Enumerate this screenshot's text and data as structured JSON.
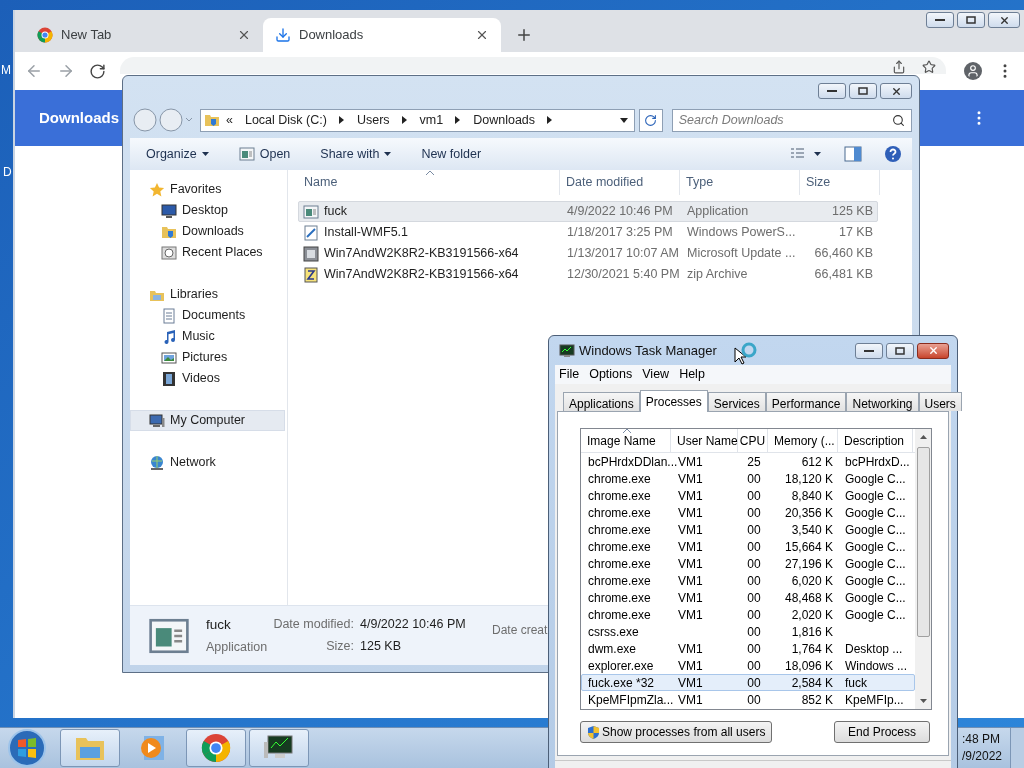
{
  "desktop": {
    "icon_labels": [
      "M",
      "D"
    ]
  },
  "browser": {
    "tabs": [
      {
        "title": "New Tab",
        "kind": "chrome",
        "selected": false
      },
      {
        "title": "Downloads",
        "kind": "download",
        "selected": true
      }
    ],
    "page_title": "Downloads"
  },
  "explorer": {
    "path_overflow": "«",
    "breadcrumb": [
      "Local Disk (C:)",
      "Users",
      "vm1",
      "Downloads"
    ],
    "search_placeholder": "Search Downloads",
    "toolbar": [
      {
        "label": "Organize",
        "kind": "menu"
      },
      {
        "label": "Open",
        "kind": "open"
      },
      {
        "label": "Share with",
        "kind": "menu"
      },
      {
        "label": "New folder",
        "kind": "plain"
      }
    ],
    "nav": [
      {
        "label": "Favorites",
        "kind": "star",
        "selected": false,
        "children": [
          {
            "label": "Desktop",
            "kind": "desktop",
            "selected": false
          },
          {
            "label": "Downloads",
            "kind": "folder",
            "selected": false
          },
          {
            "label": "Recent Places",
            "kind": "recent",
            "selected": false
          }
        ]
      },
      {
        "label": "Libraries",
        "kind": "library",
        "selected": false,
        "children": [
          {
            "label": "Documents",
            "kind": "documents",
            "selected": false
          },
          {
            "label": "Music",
            "kind": "music",
            "selected": false
          },
          {
            "label": "Pictures",
            "kind": "pictures",
            "selected": false
          },
          {
            "label": "Videos",
            "kind": "videos",
            "selected": false
          }
        ]
      },
      {
        "label": "My Computer",
        "kind": "computer",
        "selected": true
      },
      {
        "label": "Network",
        "kind": "network",
        "selected": false
      }
    ],
    "columns": [
      "Name",
      "Date modified",
      "Type",
      "Size"
    ],
    "files": [
      {
        "name": "fuck",
        "date": "4/9/2022 10:46 PM",
        "type": "Application",
        "size": "125 KB",
        "kind": "app",
        "selected": true
      },
      {
        "name": "Install-WMF5.1",
        "date": "1/18/2017 3:25 PM",
        "type": "Windows PowerS...",
        "size": "17 KB",
        "kind": "script",
        "selected": false
      },
      {
        "name": "Win7AndW2K8R2-KB3191566-x64",
        "date": "1/13/2017 10:07 AM",
        "type": "Microsoft Update ...",
        "size": "66,460 KB",
        "kind": "update",
        "selected": false
      },
      {
        "name": "Win7AndW2K8R2-KB3191566-x64",
        "date": "12/30/2021 5:40 PM",
        "type": "zip Archive",
        "size": "66,481 KB",
        "kind": "zip",
        "selected": false
      }
    ],
    "details": {
      "name": "fuck",
      "type": "Application",
      "fields": [
        {
          "label": "Date modified:",
          "value": "4/9/2022 10:46 PM"
        },
        {
          "label": "Size:",
          "value": "125 KB"
        }
      ],
      "more_label": "Date creat"
    }
  },
  "task_manager": {
    "title": "Windows Task Manager",
    "menu": [
      "File",
      "Options",
      "View",
      "Help"
    ],
    "tabs": [
      {
        "label": "Applications",
        "selected": false
      },
      {
        "label": "Processes",
        "selected": true
      },
      {
        "label": "Services",
        "selected": false
      },
      {
        "label": "Performance",
        "selected": false
      },
      {
        "label": "Networking",
        "selected": false
      },
      {
        "label": "Users",
        "selected": false
      }
    ],
    "columns": [
      "Image Name",
      "User Name",
      "CPU",
      "Memory (...",
      "Description"
    ],
    "rows": [
      {
        "image": "bcPHrdxDDlan...",
        "user": "VM1",
        "cpu": "25",
        "memory": "612 K",
        "description": "bcPHrdxD...",
        "selected": false
      },
      {
        "image": "chrome.exe",
        "user": "VM1",
        "cpu": "00",
        "memory": "18,120 K",
        "description": "Google C...",
        "selected": false
      },
      {
        "image": "chrome.exe",
        "user": "VM1",
        "cpu": "00",
        "memory": "8,840 K",
        "description": "Google C...",
        "selected": false
      },
      {
        "image": "chrome.exe",
        "user": "VM1",
        "cpu": "00",
        "memory": "20,356 K",
        "description": "Google C...",
        "selected": false
      },
      {
        "image": "chrome.exe",
        "user": "VM1",
        "cpu": "00",
        "memory": "3,540 K",
        "description": "Google C...",
        "selected": false
      },
      {
        "image": "chrome.exe",
        "user": "VM1",
        "cpu": "00",
        "memory": "15,664 K",
        "description": "Google C...",
        "selected": false
      },
      {
        "image": "chrome.exe",
        "user": "VM1",
        "cpu": "00",
        "memory": "27,196 K",
        "description": "Google C...",
        "selected": false
      },
      {
        "image": "chrome.exe",
        "user": "VM1",
        "cpu": "00",
        "memory": "6,020 K",
        "description": "Google C...",
        "selected": false
      },
      {
        "image": "chrome.exe",
        "user": "VM1",
        "cpu": "00",
        "memory": "48,468 K",
        "description": "Google C...",
        "selected": false
      },
      {
        "image": "chrome.exe",
        "user": "VM1",
        "cpu": "00",
        "memory": "2,020 K",
        "description": "Google C...",
        "selected": false
      },
      {
        "image": "csrss.exe",
        "cpu": "00",
        "memory": "1,816 K",
        "selected": false
      },
      {
        "image": "dwm.exe",
        "user": "VM1",
        "cpu": "00",
        "memory": "1,764 K",
        "description": "Desktop ...",
        "selected": false
      },
      {
        "image": "explorer.exe",
        "user": "VM1",
        "cpu": "00",
        "memory": "18,096 K",
        "description": "Windows ...",
        "selected": false
      },
      {
        "image": "fuck.exe *32",
        "user": "VM1",
        "cpu": "00",
        "memory": "2,584 K",
        "description": "fuck",
        "selected": true
      },
      {
        "image": "KpeMFIpmZla...",
        "user": "VM1",
        "cpu": "00",
        "memory": "852 K",
        "description": "KpeMFIp...",
        "selected": false
      }
    ],
    "buttons": [
      {
        "label": "Show processes from all users",
        "shield": true
      },
      {
        "label": "End Process",
        "shield": false
      }
    ]
  },
  "taskbar": {
    "apps": [
      {
        "kind": "folder",
        "running": true
      },
      {
        "kind": "media",
        "running": false
      },
      {
        "kind": "chrome",
        "running": true
      },
      {
        "kind": "monitor",
        "running": true
      }
    ],
    "clock": {
      "time": ":48 PM",
      "date": "/9/2022"
    }
  }
}
